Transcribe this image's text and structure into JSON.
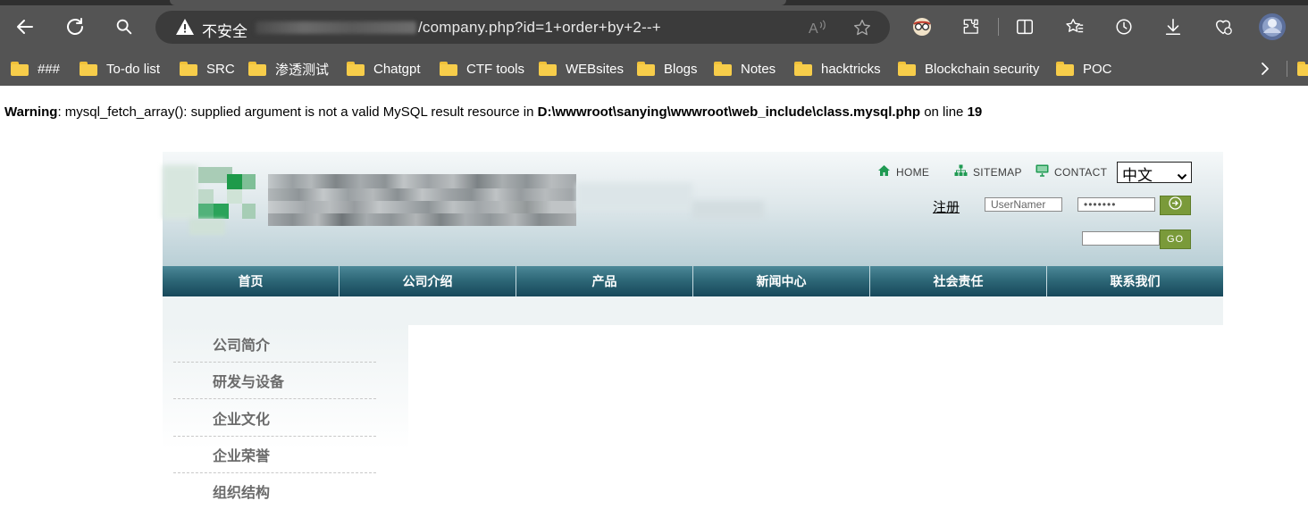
{
  "browser": {
    "security_label": "不安全",
    "url": "/company.php?id=1+order+by+2--+",
    "icons": [
      "back-icon",
      "reload-icon",
      "search-icon",
      "warning-icon",
      "read-aloud-icon",
      "favorite-star-icon",
      "profile-extension-icon",
      "extensions-icon",
      "split-screen-icon",
      "favorites-icon",
      "history-icon",
      "downloads-icon",
      "browser-essentials-icon",
      "avatar"
    ]
  },
  "bookmarks": [
    "###",
    "To-do list",
    "SRC",
    "渗透测试",
    "Chatgpt",
    "CTF tools",
    "WEBsites",
    "Blogs",
    "Notes",
    "hacktricks",
    "Blockchain security",
    "POC"
  ],
  "warning": {
    "label": "Warning",
    "text": ": mysql_fetch_array(): supplied argument is not a valid MySQL result resource in ",
    "path": "D:\\wwwroot\\sanying\\wwwroot\\web_include\\class.mysql.php",
    "on_line": " on line ",
    "line": "19"
  },
  "site": {
    "top_links": {
      "home": "HOME",
      "sitemap": "SITEMAP",
      "contact": "CONTACT"
    },
    "language": "中文",
    "register": "注册",
    "username_placeholder": "UserNamer",
    "password_value": "•••••••",
    "go_label": "GO",
    "nav": [
      "首页",
      "公司介绍",
      "产品",
      "新闻中心",
      "社会责任",
      "联系我们"
    ],
    "side_menu": [
      "公司简介",
      "研发与设备",
      "企业文化",
      "企业荣誉",
      "组织结构"
    ],
    "colors": {
      "nav": "#2e6878",
      "button": "#7a9a3a",
      "side_text": "#6b6b6b"
    }
  }
}
